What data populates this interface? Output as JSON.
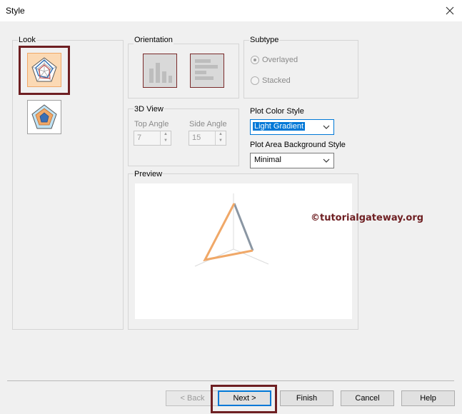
{
  "window": {
    "title": "Style"
  },
  "look": {
    "label": "Look",
    "options": [
      "radar-lines-icon",
      "radar-filled-icon"
    ],
    "selected": 0
  },
  "orientation": {
    "label": "Orientation",
    "buttons": [
      "vertical-orientation-icon",
      "horizontal-orientation-icon"
    ]
  },
  "subtype": {
    "label": "Subtype",
    "options": [
      {
        "label": "Overlayed",
        "checked": true
      },
      {
        "label": "Stacked",
        "checked": false
      }
    ]
  },
  "view3d": {
    "label": "3D View",
    "top_angle_label": "Top Angle",
    "top_angle_value": "7",
    "side_angle_label": "Side Angle",
    "side_angle_value": "15"
  },
  "plot_color_style": {
    "label": "Plot Color Style",
    "value": "Light Gradient"
  },
  "plot_area_bg": {
    "label": "Plot Area Background Style",
    "value": "Minimal"
  },
  "preview": {
    "label": "Preview"
  },
  "watermark": "©tutorialgateway.org",
  "buttons": {
    "back": "< Back",
    "next": "Next >",
    "finish": "Finish",
    "cancel": "Cancel",
    "help": "Help"
  },
  "colors": {
    "highlight": "#6e1f22",
    "accent": "#0078d7",
    "radar_orange": "#f0a868",
    "radar_grey": "#8a96a3"
  }
}
